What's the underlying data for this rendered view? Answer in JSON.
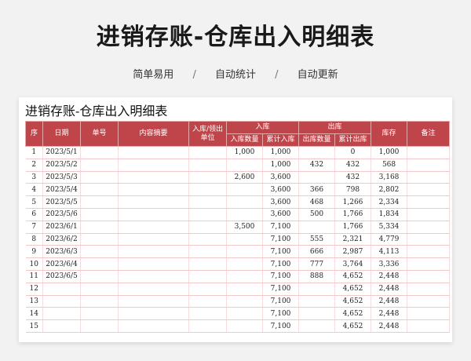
{
  "banner": {
    "title": "进销存账-仓库出入明细表",
    "features": [
      "简单易用",
      "自动统计",
      "自动更新"
    ],
    "separator": "/"
  },
  "sheet": {
    "title": "进销存账-仓库出入明细表",
    "header_color": "#c0454a",
    "headers": {
      "seq": "序",
      "date": "日期",
      "doc_no": "单号",
      "summary": "内容摘要",
      "unit": "入库/领出单位",
      "inbound": "入库",
      "outbound": "出库",
      "stock": "库存",
      "remark": "备注",
      "in_qty": "入库数量",
      "in_total": "累计入库",
      "out_qty": "出库数量",
      "out_total": "累计出库"
    },
    "rows": [
      {
        "seq": "1",
        "date": "2023/5/1",
        "in_qty": "1,000",
        "in_total": "1,000",
        "out_qty": "",
        "out_total": "0",
        "stock": "1,000"
      },
      {
        "seq": "2",
        "date": "2023/5/2",
        "in_qty": "",
        "in_total": "1,000",
        "out_qty": "432",
        "out_total": "432",
        "stock": "568"
      },
      {
        "seq": "3",
        "date": "2023/5/3",
        "in_qty": "2,600",
        "in_total": "3,600",
        "out_qty": "",
        "out_total": "432",
        "stock": "3,168"
      },
      {
        "seq": "4",
        "date": "2023/5/4",
        "in_qty": "",
        "in_total": "3,600",
        "out_qty": "366",
        "out_total": "798",
        "stock": "2,802"
      },
      {
        "seq": "5",
        "date": "2023/5/5",
        "in_qty": "",
        "in_total": "3,600",
        "out_qty": "468",
        "out_total": "1,266",
        "stock": "2,334"
      },
      {
        "seq": "6",
        "date": "2023/5/6",
        "in_qty": "",
        "in_total": "3,600",
        "out_qty": "500",
        "out_total": "1,766",
        "stock": "1,834"
      },
      {
        "seq": "7",
        "date": "2023/6/1",
        "in_qty": "3,500",
        "in_total": "7,100",
        "out_qty": "",
        "out_total": "1,766",
        "stock": "5,334"
      },
      {
        "seq": "8",
        "date": "2023/6/2",
        "in_qty": "",
        "in_total": "7,100",
        "out_qty": "555",
        "out_total": "2,321",
        "stock": "4,779"
      },
      {
        "seq": "9",
        "date": "2023/6/3",
        "in_qty": "",
        "in_total": "7,100",
        "out_qty": "666",
        "out_total": "2,987",
        "stock": "4,113"
      },
      {
        "seq": "10",
        "date": "2023/6/4",
        "in_qty": "",
        "in_total": "7,100",
        "out_qty": "777",
        "out_total": "3,764",
        "stock": "3,336"
      },
      {
        "seq": "11",
        "date": "2023/6/5",
        "in_qty": "",
        "in_total": "7,100",
        "out_qty": "888",
        "out_total": "4,652",
        "stock": "2,448"
      },
      {
        "seq": "12",
        "date": "",
        "in_qty": "",
        "in_total": "7,100",
        "out_qty": "",
        "out_total": "4,652",
        "stock": "2,448"
      },
      {
        "seq": "13",
        "date": "",
        "in_qty": "",
        "in_total": "7,100",
        "out_qty": "",
        "out_total": "4,652",
        "stock": "2,448"
      },
      {
        "seq": "14",
        "date": "",
        "in_qty": "",
        "in_total": "7,100",
        "out_qty": "",
        "out_total": "4,652",
        "stock": "2,448"
      },
      {
        "seq": "15",
        "date": "",
        "in_qty": "",
        "in_total": "7,100",
        "out_qty": "",
        "out_total": "4,652",
        "stock": "2,448"
      }
    ]
  }
}
